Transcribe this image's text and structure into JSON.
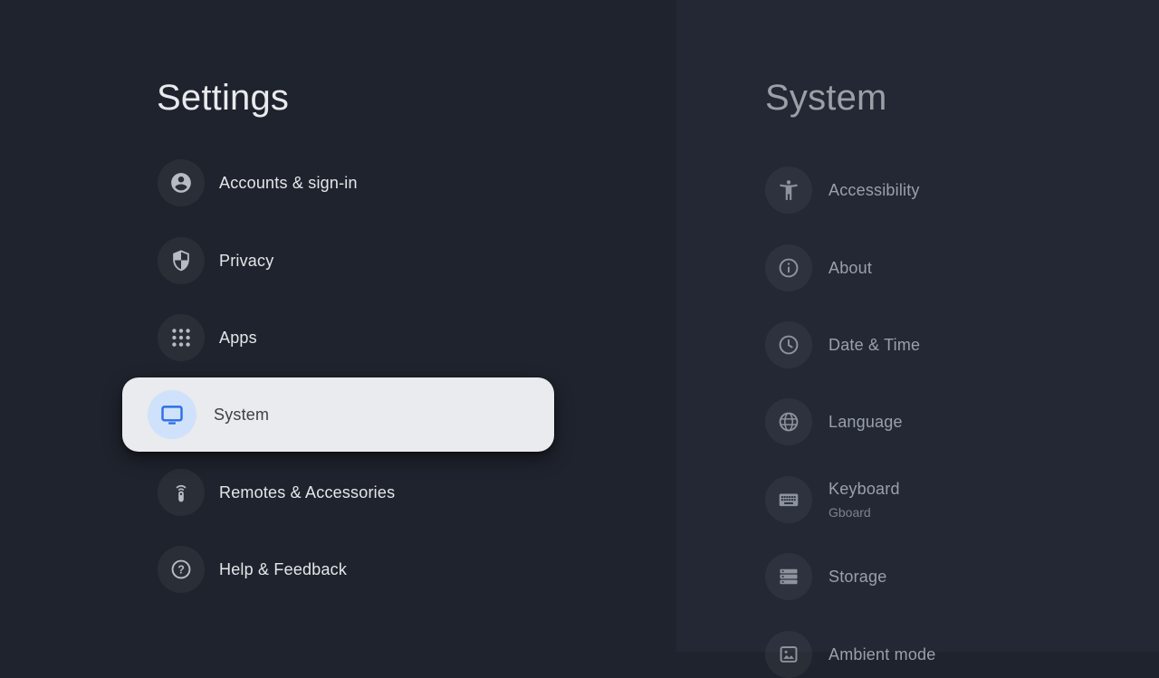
{
  "left_panel": {
    "title": "Settings",
    "items": [
      {
        "label": "Accounts & sign-in",
        "icon": "account-circle-icon",
        "selected": false
      },
      {
        "label": "Privacy",
        "icon": "shield-icon",
        "selected": false
      },
      {
        "label": "Apps",
        "icon": "apps-grid-icon",
        "selected": false
      },
      {
        "label": "System",
        "icon": "tv-icon",
        "selected": true
      },
      {
        "label": "Remotes & Accessories",
        "icon": "remote-icon",
        "selected": false
      },
      {
        "label": "Help & Feedback",
        "icon": "help-icon",
        "selected": false
      }
    ]
  },
  "right_panel": {
    "title": "System",
    "items": [
      {
        "label": "Accessibility",
        "icon": "accessibility-icon"
      },
      {
        "label": "About",
        "icon": "info-icon"
      },
      {
        "label": "Date & Time",
        "icon": "clock-icon"
      },
      {
        "label": "Language",
        "icon": "globe-icon"
      },
      {
        "label": "Keyboard",
        "sublabel": "Gboard",
        "icon": "keyboard-icon"
      },
      {
        "label": "Storage",
        "icon": "storage-icon"
      },
      {
        "label": "Ambient mode",
        "icon": "ambient-mode-icon"
      }
    ]
  },
  "colors": {
    "background_left": "#1f232d",
    "background_right": "#232834",
    "selected_row_background": "#e9ebee",
    "selected_icon_circle": "#d0e1fb",
    "accent_blue": "#2e6fe8",
    "primary_text": "#e4e6e9",
    "secondary_text": "#9aa0a8",
    "selected_text": "#3c4147"
  }
}
